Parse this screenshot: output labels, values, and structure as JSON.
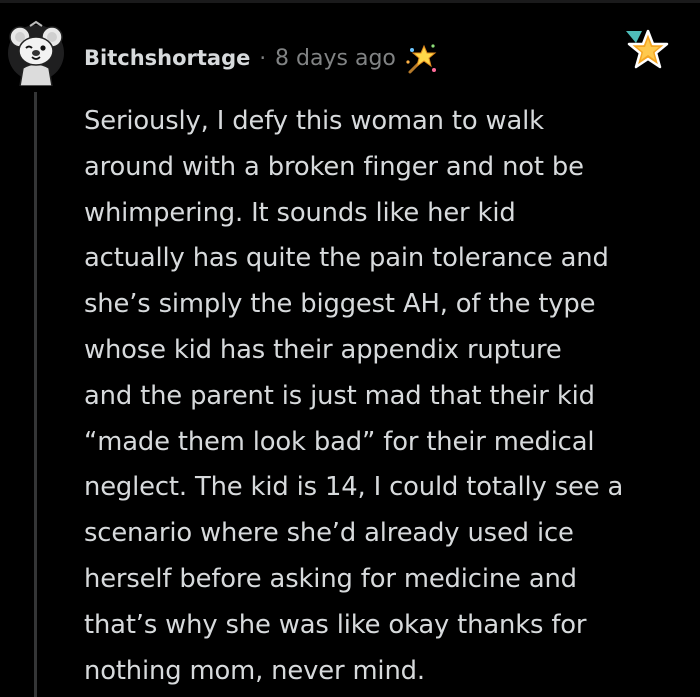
{
  "comment": {
    "username": "Bitchshortage",
    "separator": "·",
    "timestamp": "8 days ago",
    "avatar_icon": "snoo-koala-avatar-icon",
    "award_icon": "sparkle-award-icon",
    "badge_icon": "star-badge-icon",
    "body_lines": [
      "Seriously, I defy this woman to walk",
      "around with a broken finger and not be",
      "whimpering. It sounds like her kid",
      "actually has quite the pain tolerance and",
      "she’s simply the biggest AH, of the type",
      "whose kid has their appendix rupture",
      "and the parent is just mad that their kid",
      "“made them look bad” for their medical",
      "neglect. The kid is 14, I could totally see a",
      "scenario where she’d already used ice",
      "herself before asking for medicine and",
      "that’s why she was like okay thanks for",
      "nothing mom, never mind."
    ]
  },
  "colors": {
    "background": "#000000",
    "text": "#d7dadc",
    "muted": "#818384",
    "thread_line": "#343536",
    "badge_gold": "#f5a623",
    "badge_teal": "#4fbdba"
  }
}
